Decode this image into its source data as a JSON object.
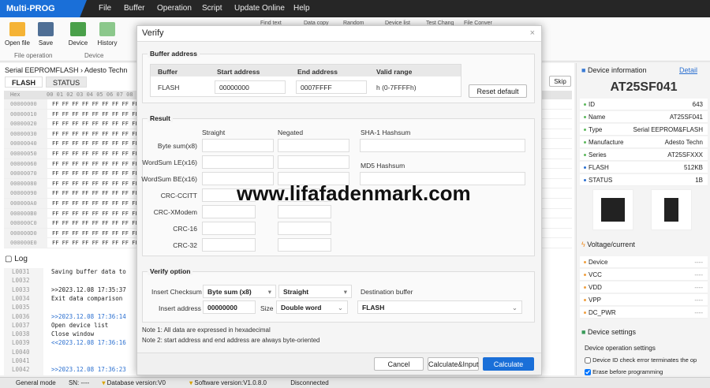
{
  "app": {
    "title": "Multi-PROG",
    "menu": [
      "File",
      "Buffer",
      "Operation",
      "Script",
      "Update Online",
      "Help"
    ]
  },
  "toolbar": {
    "open_file": "Open file",
    "save": "Save",
    "device": "Device",
    "history": "History",
    "group_file": "File operation",
    "group_device": "Device",
    "find_text": "Find text",
    "data_copy": "Data copy",
    "random": "Random",
    "device_list": "Device list",
    "test_chang": "Test Chang",
    "file_conver": "File Conver"
  },
  "left": {
    "breadcrumb": [
      "Serial EEPROMFLASH",
      "Adesto Techn"
    ],
    "tabs": [
      "FLASH",
      "STATUS"
    ],
    "skip": "Skip",
    "hex_header": "Hex",
    "hex_cols": "00 01 02 03 04 05 06 07 08 09 0A 0B 0C 0D 0E 0F",
    "hex_rows": [
      [
        "00000000",
        "FF FF FF FF FF FF FF FF FF FF FF FF FF FF FF FF"
      ],
      [
        "00000010",
        "FF FF FF FF FF FF FF FF FF FF FF FF FF FF FF FF"
      ],
      [
        "00000020",
        "FF FF FF FF FF FF FF FF FF FF FF FF FF FF FF FF"
      ],
      [
        "00000030",
        "FF FF FF FF FF FF FF FF FF FF FF FF FF FF FF FF"
      ],
      [
        "00000040",
        "FF FF FF FF FF FF FF FF FF FF FF FF FF FF FF FF"
      ],
      [
        "00000050",
        "FF FF FF FF FF FF FF FF FF FF FF FF FF FF FF FF"
      ],
      [
        "00000060",
        "FF FF FF FF FF FF FF FF FF FF FF FF FF FF FF FF"
      ],
      [
        "00000070",
        "FF FF FF FF FF FF FF FF FF FF FF FF FF FF FF FF"
      ],
      [
        "00000080",
        "FF FF FF FF FF FF FF FF FF FF FF FF FF FF FF FF"
      ],
      [
        "00000090",
        "FF FF FF FF FF FF FF FF FF FF FF FF FF FF FF FF"
      ],
      [
        "000000A0",
        "FF FF FF FF FF FF FF FF FF FF FF FF FF FF FF FF"
      ],
      [
        "000000B0",
        "FF FF FF FF FF FF FF FF FF FF FF FF FF FF FF FF"
      ],
      [
        "000000C0",
        "FF FF FF FF FF FF FF FF FF FF FF FF FF FF FF FF"
      ],
      [
        "000000D0",
        "FF FF FF FF FF FF FF FF FF FF FF FF FF FF FF FF"
      ],
      [
        "000000E0",
        "FF FF FF FF FF FF FF FF FF FF FF FF FF FF FF FF"
      ]
    ]
  },
  "log": {
    "title": "Log",
    "rows": [
      [
        "L0031",
        "Saving buffer data to",
        ""
      ],
      [
        "L0032",
        "",
        ""
      ],
      [
        "L0033",
        ">>2023.12.08 17:35:37",
        ""
      ],
      [
        "L0034",
        "Exit data comparison",
        ""
      ],
      [
        "L0035",
        "",
        ""
      ],
      [
        "L0036",
        ">>2023.12.08 17:36:14",
        ""
      ],
      [
        "L0037",
        "Open device list",
        ""
      ],
      [
        "L0038",
        "Close window",
        ""
      ],
      [
        "L0039",
        "<<2023.12.08 17:36:16",
        ""
      ],
      [
        "L0040",
        "",
        ""
      ],
      [
        "L0041",
        "",
        ""
      ],
      [
        "L0042",
        ">>2023.12.08 17:36:23",
        ""
      ]
    ]
  },
  "device_info": {
    "title": "Device information",
    "detail": "Detail",
    "chip": "AT25SF041",
    "rows": [
      [
        "ID",
        "643"
      ],
      [
        "Name",
        "AT25SF041"
      ],
      [
        "Type",
        "Serial EEPROM&FLASH"
      ],
      [
        "Manufacture",
        "Adesto Techn"
      ],
      [
        "Series",
        "AT25SFXXX"
      ],
      [
        "FLASH",
        "512KB"
      ],
      [
        "STATUS",
        "1B"
      ]
    ]
  },
  "voltage": {
    "title": "Voltage/current",
    "rows": [
      [
        "Device",
        "----"
      ],
      [
        "VCC",
        "----"
      ],
      [
        "VDD",
        "----"
      ],
      [
        "VPP",
        "----"
      ],
      [
        "DC_PWR",
        "----"
      ]
    ]
  },
  "settings": {
    "title": "Device settings",
    "group": "Device operation settings",
    "opt1": "Device ID check error terminates the op",
    "opt1_checked": false,
    "opt2": "Erase before programming",
    "opt2_checked": true
  },
  "status": {
    "mode": "General mode",
    "sn": "SN: ----",
    "db": "Database version:V0",
    "sw": "Software version:V1.0.8.0",
    "conn": "Disconnected"
  },
  "dialog": {
    "title": "Verify",
    "buffer_section": "Buffer address",
    "cols": [
      "Buffer",
      "Start address",
      "End address",
      "Valid range"
    ],
    "buffer": "FLASH",
    "start": "00000000",
    "end": "0007FFFF",
    "range": "h (0-7FFFFh)",
    "reset": "Reset default",
    "result_section": "Result",
    "straight": "Straight",
    "negated": "Negated",
    "sha1": "SHA-1 Hashsum",
    "md5": "MD5 Hashsum",
    "result_rows": [
      "Byte sum(x8)",
      "WordSum LE(x16)",
      "WordSum BE(x16)",
      "CRC-CCITT",
      "CRC-XModem",
      "CRC-16",
      "CRC-32"
    ],
    "verify_section": "Verify option",
    "insert_checksum": "Insert Checksum",
    "checksum_sel": "Byte sum (x8)",
    "direction_sel": "Straight",
    "dest_buffer": "Destination buffer",
    "insert_address": "Insert address",
    "insert_addr_val": "00000000",
    "size": "Size",
    "size_sel": "Double word",
    "dest_sel": "FLASH",
    "note1": "Note 1: All data are expressed in hexadecimal",
    "note2": "Note 2: start address and end address are always byte-oriented",
    "cancel": "Cancel",
    "calc_input": "Calculate&Input",
    "calculate": "Calculate"
  },
  "watermark": "www.lifafadenmark.com",
  "colors": {
    "accent": "#1a6fd8",
    "titlebar": "#262626"
  }
}
